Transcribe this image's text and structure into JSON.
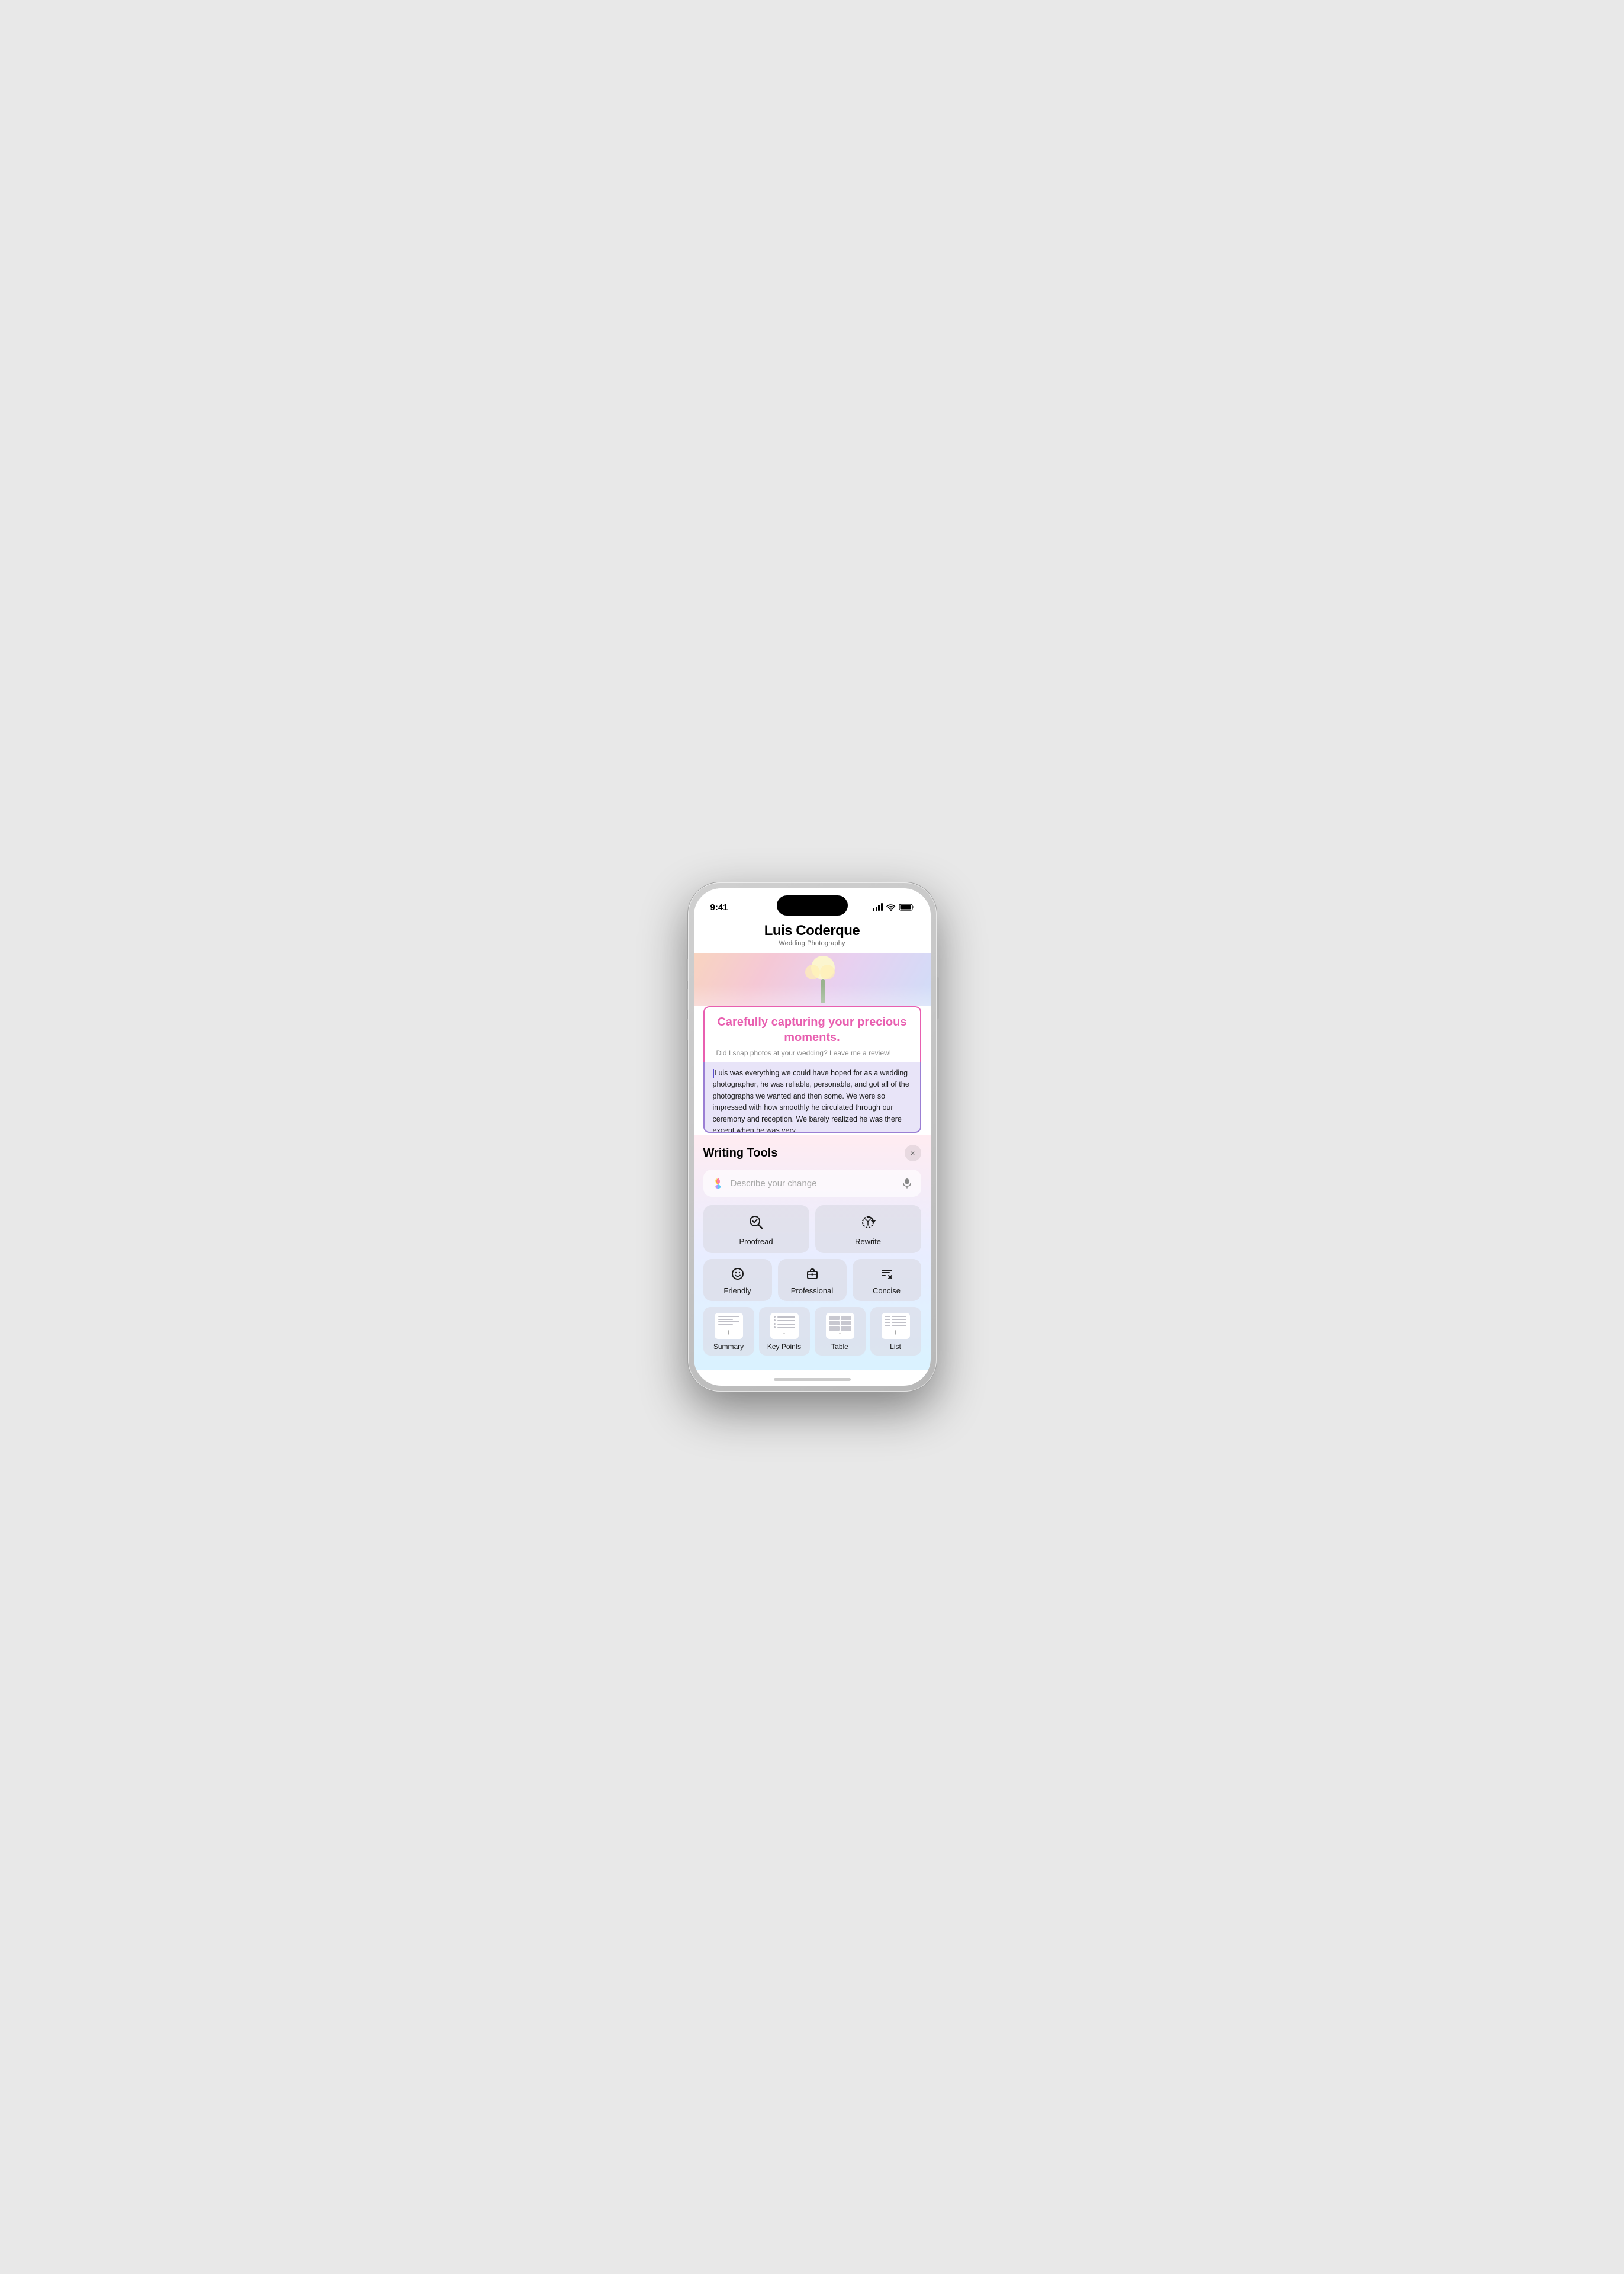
{
  "status_bar": {
    "time": "9:41",
    "signal_label": "signal",
    "wifi_label": "wifi",
    "battery_label": "battery"
  },
  "app_header": {
    "title": "Luis Coderque",
    "subtitle": "Wedding Photography"
  },
  "content": {
    "tagline": "Carefully capturing your precious moments.",
    "review_prompt": "Did I snap photos at your wedding? Leave me a review!",
    "selected_text": "Luis was everything we could have hoped for as a wedding photographer, he was reliable, personable, and got all of the photographs we wanted and then some. We were so impressed with how smoothly he circulated through our ceremony and reception. We barely realized he was there except when he was very"
  },
  "writing_tools": {
    "title": "Writing Tools",
    "close_label": "×",
    "describe_placeholder": "Describe your change",
    "tools": {
      "proofread": "Proofread",
      "rewrite": "Rewrite",
      "friendly": "Friendly",
      "professional": "Professional",
      "concise": "Concise",
      "summary": "Summary",
      "key_points": "Key Points",
      "table": "Table",
      "list": "List"
    }
  }
}
